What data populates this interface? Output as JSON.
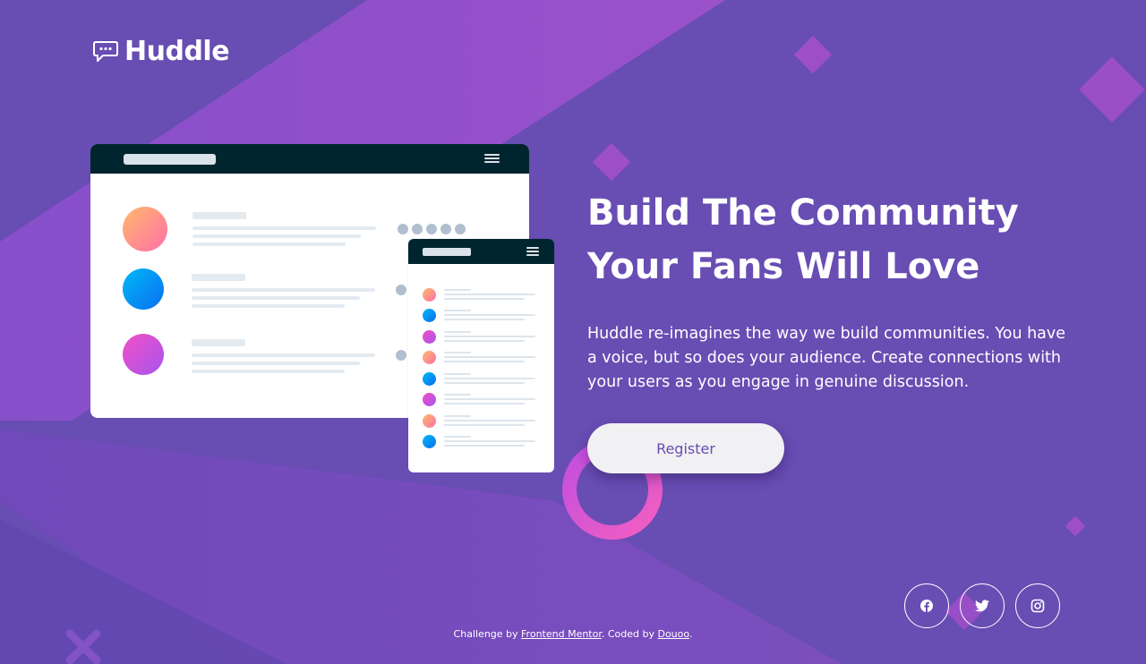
{
  "brand": {
    "name": "Huddle"
  },
  "hero": {
    "title_line1": "Build The Community",
    "title_line2": "Your Fans Will Love",
    "description": "Huddle re-imagines the way we build communities. You have a voice, but so does your audience. Create connections with your users as you engage in genuine discussion.",
    "cta_label": "Register"
  },
  "social": [
    {
      "name": "facebook",
      "icon": "facebook-icon"
    },
    {
      "name": "twitter",
      "icon": "twitter-icon"
    },
    {
      "name": "instagram",
      "icon": "instagram-icon"
    }
  ],
  "footer": {
    "prefix": "Challenge by ",
    "link1": "Frontend Mentor",
    "middle": ". Coded by ",
    "link2": "Douoo",
    "suffix": "."
  },
  "colors": {
    "background": "#684db3",
    "accent_pink": "#e55bd6",
    "text": "#ffffff",
    "button_text": "#684db3"
  }
}
